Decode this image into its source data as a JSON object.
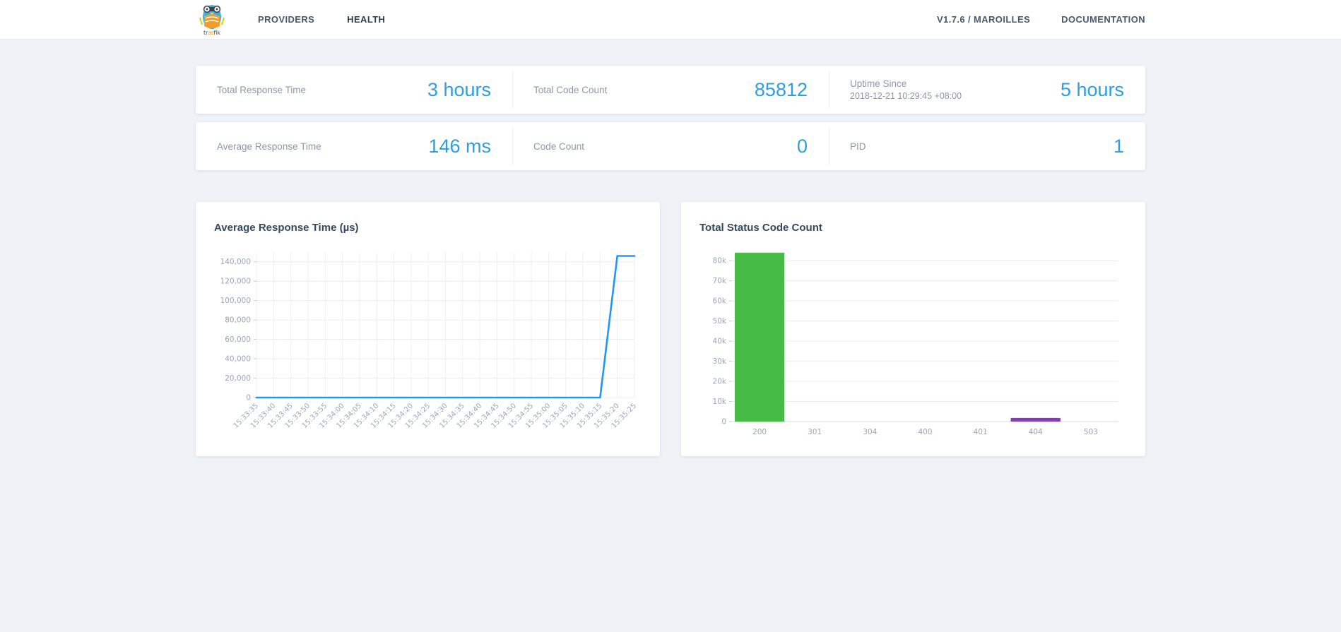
{
  "header": {
    "brand": "traefik",
    "nav": [
      {
        "label": "PROVIDERS",
        "active": false
      },
      {
        "label": "HEALTH",
        "active": true
      }
    ],
    "version_label": "V1.7.6 / MAROILLES",
    "documentation_label": "DOCUMENTATION"
  },
  "stats": {
    "row1": [
      {
        "label": "Total Response Time",
        "value": "3 hours"
      },
      {
        "label": "Total Code Count",
        "value": "85812"
      },
      {
        "label": "Uptime Since",
        "sublabel": "2018-12-21 10:29:45 +08:00",
        "value": "5 hours"
      }
    ],
    "row2": [
      {
        "label": "Average Response Time",
        "value": "146 ms"
      },
      {
        "label": "Code Count",
        "value": "0"
      },
      {
        "label": "PID",
        "value": "1"
      }
    ]
  },
  "colors": {
    "accent_blue": "#2d9ee3",
    "line_blue": "#2196f3",
    "bar_green": "#46bc46",
    "bar_purple": "#8040a8",
    "tick_text": "#9aa5b8",
    "grid": "#e9ecf3"
  },
  "chart_data": [
    {
      "type": "line",
      "title": "Average Response Time (µs)",
      "x": [
        "15:33:35",
        "15:33:40",
        "15:33:45",
        "15:33:50",
        "15:33:55",
        "15:34:00",
        "15:34:05",
        "15:34:10",
        "15:34:15",
        "15:34:20",
        "15:34:25",
        "15:34:30",
        "15:34:35",
        "15:34:40",
        "15:34:45",
        "15:34:50",
        "15:34:55",
        "15:35:00",
        "15:35:05",
        "15:35:10",
        "15:35:15",
        "15:35:20",
        "15:35:25"
      ],
      "values": [
        0,
        0,
        0,
        0,
        0,
        0,
        0,
        0,
        0,
        0,
        0,
        0,
        0,
        0,
        0,
        0,
        0,
        0,
        0,
        0,
        0,
        146000,
        146000
      ],
      "yticks": [
        0,
        20000,
        40000,
        60000,
        80000,
        100000,
        120000,
        140000
      ],
      "ytick_labels": [
        "0",
        "20,000",
        "40,000",
        "60,000",
        "80,000",
        "100,000",
        "120,000",
        "140,000"
      ],
      "ylim": [
        0,
        150000
      ],
      "line_color": "#2196f3",
      "grid": "both",
      "legend": "none"
    },
    {
      "type": "bar",
      "title": "Total Status Code Count",
      "categories": [
        "200",
        "301",
        "304",
        "400",
        "401",
        "404",
        "503"
      ],
      "values": [
        84000,
        0,
        0,
        0,
        0,
        1800,
        0
      ],
      "colors": [
        "#46bc46",
        "#9aa5b8",
        "#9aa5b8",
        "#9aa5b8",
        "#9aa5b8",
        "#8040a8",
        "#9aa5b8"
      ],
      "yticks": [
        0,
        10000,
        20000,
        30000,
        40000,
        50000,
        60000,
        70000,
        80000
      ],
      "ytick_labels": [
        "0",
        "10k",
        "20k",
        "30k",
        "40k",
        "50k",
        "60k",
        "70k",
        "80k"
      ],
      "ylim": [
        0,
        85000
      ],
      "grid": "horizontal",
      "legend": "none"
    }
  ]
}
